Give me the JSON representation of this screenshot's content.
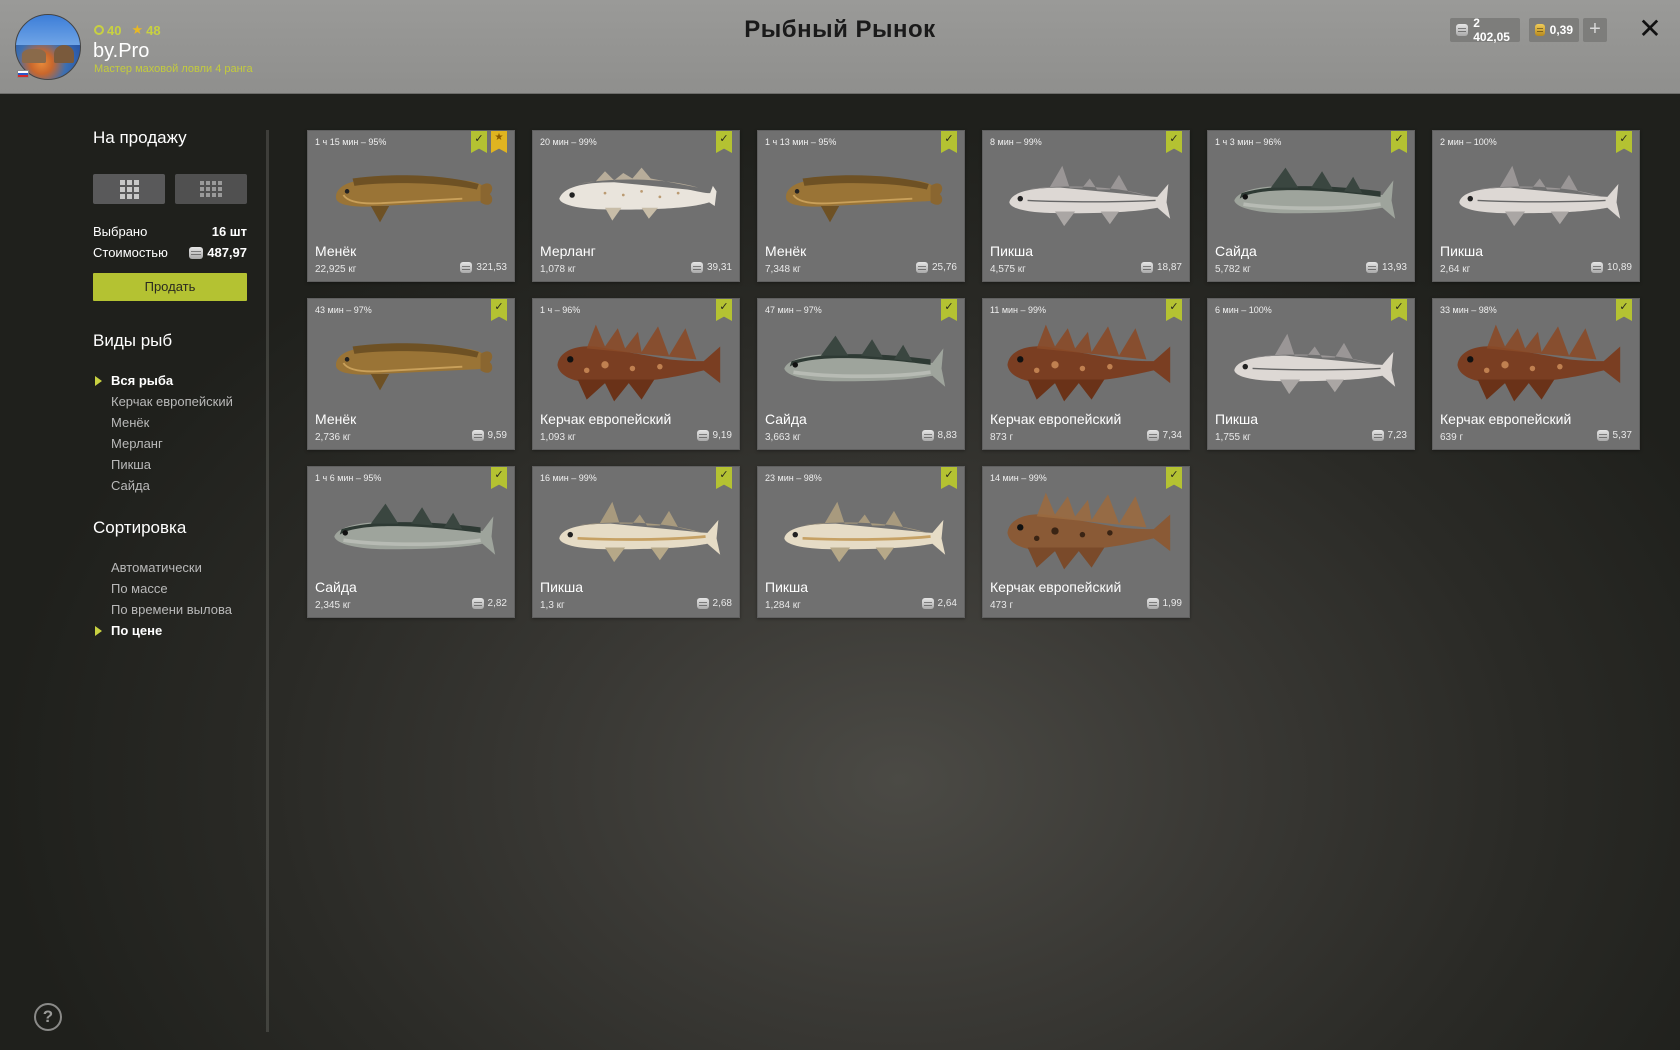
{
  "header": {
    "title": "Рыбный Рынок",
    "player": {
      "name": "by.Pro",
      "rank_text": "Мастер маховой ловли 4 ранга",
      "level": "40",
      "stars": "48"
    },
    "currency": {
      "silver": "2 402,05",
      "gold": "0,39"
    },
    "icons": {
      "close": "close-icon",
      "add": "plus-icon",
      "help": "help-icon"
    }
  },
  "sidebar": {
    "for_sale_title": "На продажу",
    "selected_label": "Выбрано",
    "selected_value": "16 шт",
    "cost_label": "Стоимостью",
    "cost_value": "487,97",
    "sell_label": "Продать",
    "species_title": "Виды рыб",
    "species": [
      "Вся рыба",
      "Керчак европейский",
      "Менёк",
      "Мерланг",
      "Пикша",
      "Сайда"
    ],
    "species_active": "Вся рыба",
    "sort_title": "Сортировка",
    "sort_options": [
      "Автоматически",
      "По массе",
      "По времени вылова",
      "По цене"
    ],
    "sort_active": "По цене",
    "help_symbol": "?"
  },
  "cards": [
    {
      "time": "1 ч 15 мин – 95%",
      "name": "Менёк",
      "weight": "22,925 кг",
      "price": "321,53",
      "kind": "tusk",
      "starred": true
    },
    {
      "time": "20 мин – 99%",
      "name": "Мерланг",
      "weight": "1,078 кг",
      "price": "39,31",
      "kind": "whiting",
      "starred": false
    },
    {
      "time": "1 ч 13 мин – 95%",
      "name": "Менёк",
      "weight": "7,348 кг",
      "price": "25,76",
      "kind": "tusk",
      "starred": false
    },
    {
      "time": "8 мин – 99%",
      "name": "Пикша",
      "weight": "4,575 кг",
      "price": "18,87",
      "kind": "haddock",
      "starred": false
    },
    {
      "time": "1 ч 3 мин – 96%",
      "name": "Сайда",
      "weight": "5,782 кг",
      "price": "13,93",
      "kind": "saithe",
      "starred": false
    },
    {
      "time": "2 мин – 100%",
      "name": "Пикша",
      "weight": "2,64 кг",
      "price": "10,89",
      "kind": "haddock",
      "starred": false
    },
    {
      "time": "43 мин – 97%",
      "name": "Менёк",
      "weight": "2,736 кг",
      "price": "9,59",
      "kind": "tusk",
      "starred": false
    },
    {
      "time": "1 ч – 96%",
      "name": "Керчак европейский",
      "weight": "1,093 кг",
      "price": "9,19",
      "kind": "sculpin",
      "starred": false
    },
    {
      "time": "47 мин – 97%",
      "name": "Сайда",
      "weight": "3,663 кг",
      "price": "8,83",
      "kind": "saithe",
      "starred": false
    },
    {
      "time": "11 мин – 99%",
      "name": "Керчак европейский",
      "weight": "873 г",
      "price": "7,34",
      "kind": "sculpin",
      "starred": false
    },
    {
      "time": "6 мин – 100%",
      "name": "Пикша",
      "weight": "1,755 кг",
      "price": "7,23",
      "kind": "haddock",
      "starred": false
    },
    {
      "time": "33 мин – 98%",
      "name": "Керчак европейский",
      "weight": "639 г",
      "price": "5,37",
      "kind": "sculpin",
      "starred": false
    },
    {
      "time": "1 ч 6 мин – 95%",
      "name": "Сайда",
      "weight": "2,345 кг",
      "price": "2,82",
      "kind": "saithe",
      "starred": false
    },
    {
      "time": "16 мин – 99%",
      "name": "Пикша",
      "weight": "1,3 кг",
      "price": "2,68",
      "kind": "haddock2",
      "starred": false
    },
    {
      "time": "23 мин – 98%",
      "name": "Пикша",
      "weight": "1,284 кг",
      "price": "2,64",
      "kind": "haddock2",
      "starred": false
    },
    {
      "time": "14 мин – 99%",
      "name": "Керчак европейский",
      "weight": "473 г",
      "price": "1,99",
      "kind": "sculpin2",
      "starred": false
    }
  ],
  "colors": {
    "accent": "#b4c232",
    "star": "#e0b420",
    "card": "#707070",
    "header": "#949492"
  }
}
